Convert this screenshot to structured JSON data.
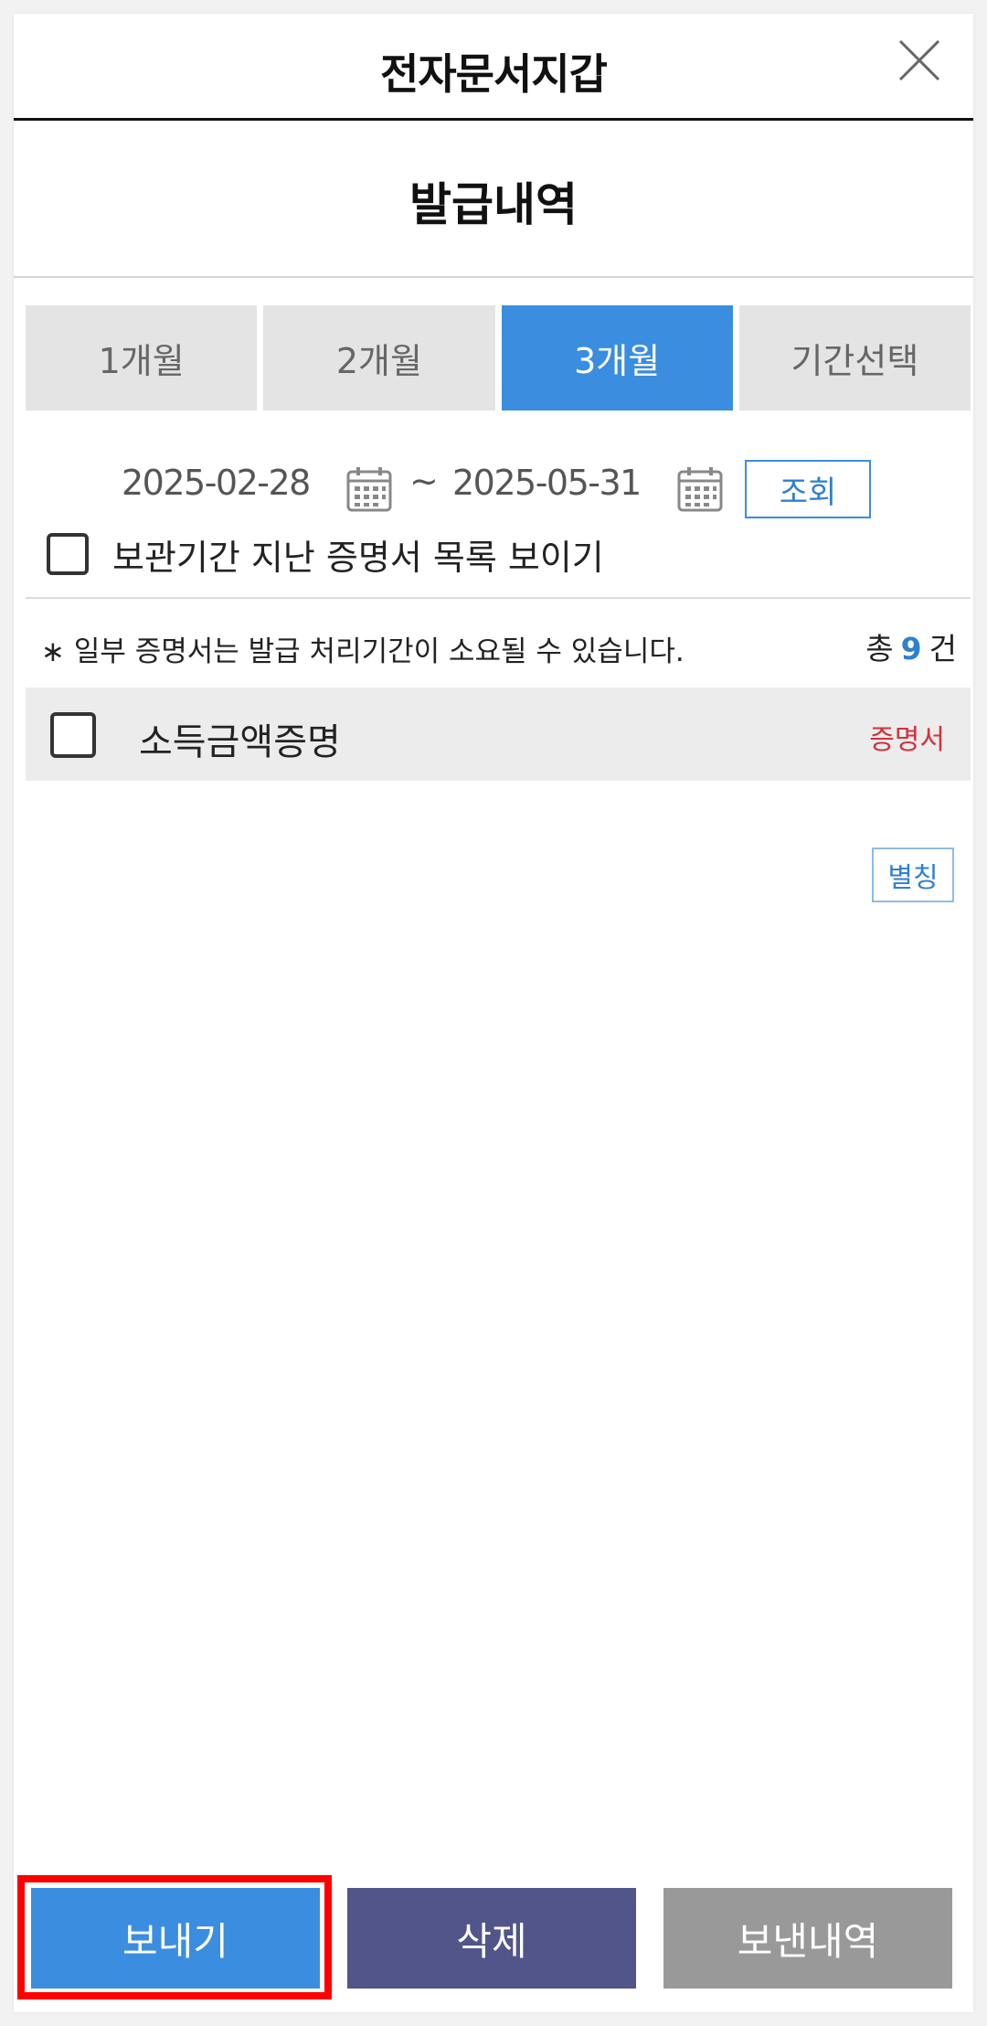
{
  "header": {
    "title": "전자문서지갑",
    "close_icon": "close-icon"
  },
  "section": {
    "title": "발급내역"
  },
  "tabs": [
    {
      "label": "1개월",
      "active": false
    },
    {
      "label": "2개월",
      "active": false
    },
    {
      "label": "3개월",
      "active": true
    },
    {
      "label": "기간선택",
      "active": false
    }
  ],
  "date_range": {
    "start": "2025-02-28",
    "separator": "~",
    "end": "2025-05-31",
    "calendar_icon": "calendar-icon",
    "search_label": "조회"
  },
  "expired_toggle": {
    "label": "보관기간 지난 증명서 목록 보이기",
    "checked": false
  },
  "notice": "∗ 일부 증명서는 발급 처리기간이 소요될 수 있습니다.",
  "count": {
    "prefix": "총",
    "value": "9",
    "suffix": "건"
  },
  "items": [
    {
      "name": "소득금액증명",
      "type": "증명서",
      "checked": false
    }
  ],
  "alias_label": "별칭",
  "bottom": {
    "send_label": "보내기",
    "delete_label": "삭제",
    "history_label": "보낸내역"
  },
  "colors": {
    "accent": "#3a8ddf",
    "delete": "#52558a",
    "history": "#999999",
    "cert_type": "#d0323c",
    "highlight": "#ff0000"
  }
}
